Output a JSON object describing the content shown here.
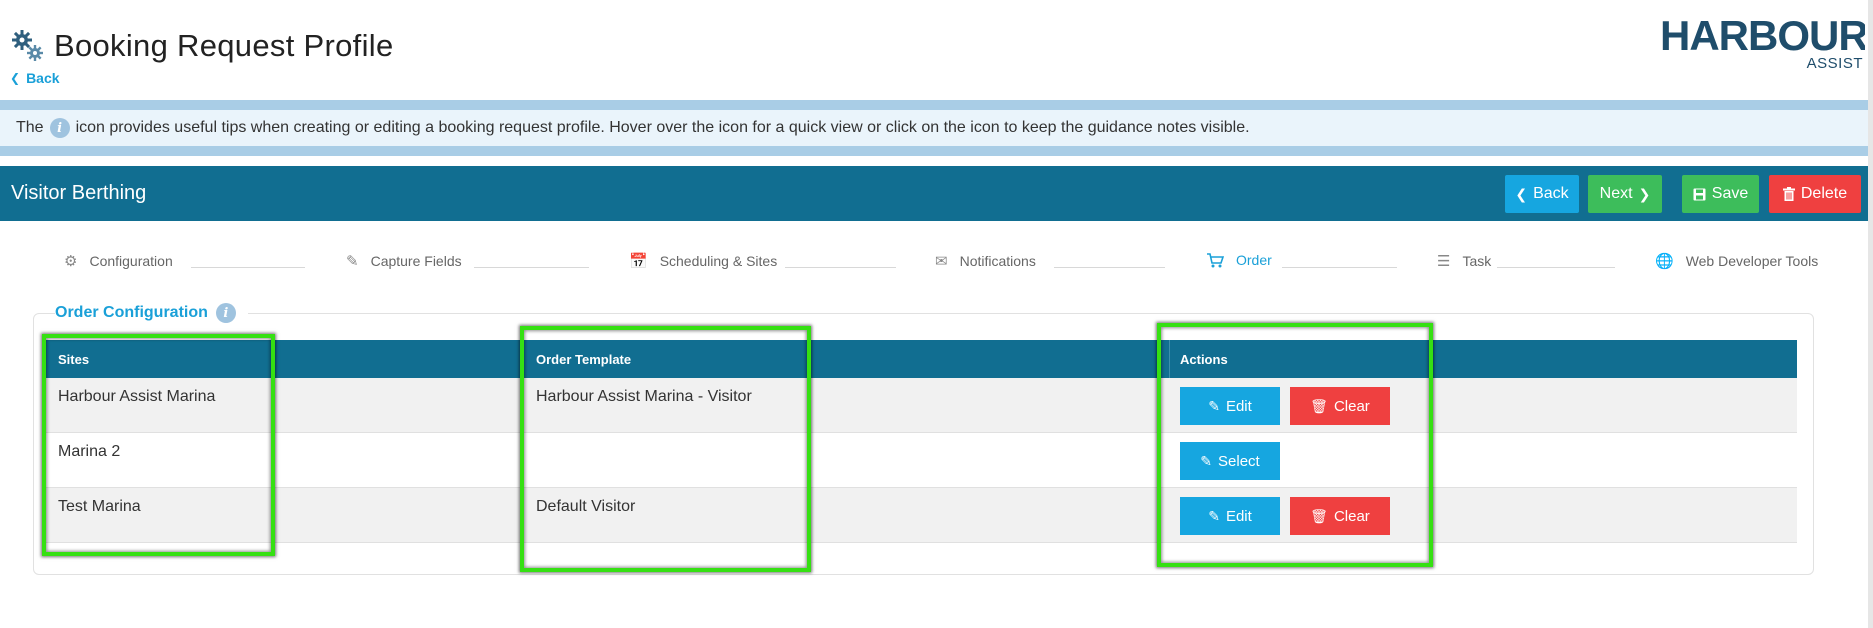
{
  "header": {
    "title": "Booking Request Profile",
    "back_label": "Back",
    "logo": {
      "brand": "HARBOUR",
      "sub": "ASSIST"
    }
  },
  "tip": {
    "prefix": "The",
    "info_glyph": "i",
    "text": "icon provides useful tips when creating or editing a booking request profile. Hover over the icon for a quick view or click on the icon to keep the guidance notes visible."
  },
  "section": {
    "title": "Visitor Berthing",
    "buttons": {
      "back": "Back",
      "next": "Next",
      "save": "Save",
      "delete": "Delete"
    }
  },
  "steps": [
    {
      "label": "Configuration",
      "icon": "gears-icon"
    },
    {
      "label": "Capture Fields",
      "icon": "edit-form-icon"
    },
    {
      "label": "Scheduling & Sites",
      "icon": "calendar-icon"
    },
    {
      "label": "Notifications",
      "icon": "envelope-icon"
    },
    {
      "label": "Order",
      "icon": "cart-icon",
      "active": true
    },
    {
      "label": "Task",
      "icon": "checklist-icon"
    },
    {
      "label": "Web Developer Tools",
      "icon": "globe-icon"
    }
  ],
  "order_config": {
    "title": "Order Configuration",
    "columns": [
      "Sites",
      "Order Template",
      "Actions"
    ],
    "rows": [
      {
        "site": "Harbour Assist Marina",
        "template": "Harbour Assist Marina - Visitor",
        "actions": [
          "Edit",
          "Clear"
        ]
      },
      {
        "site": "Marina 2",
        "template": "",
        "actions": [
          "Select"
        ]
      },
      {
        "site": "Test Marina",
        "template": "Default Visitor",
        "actions": [
          "Edit",
          "Clear"
        ]
      }
    ]
  },
  "colors": {
    "primary_dark": "#116e91",
    "accent_blue": "#16a6e0",
    "success_green": "#3dbd5b",
    "danger_red": "#ef4040",
    "highlight_green": "#35e012"
  }
}
